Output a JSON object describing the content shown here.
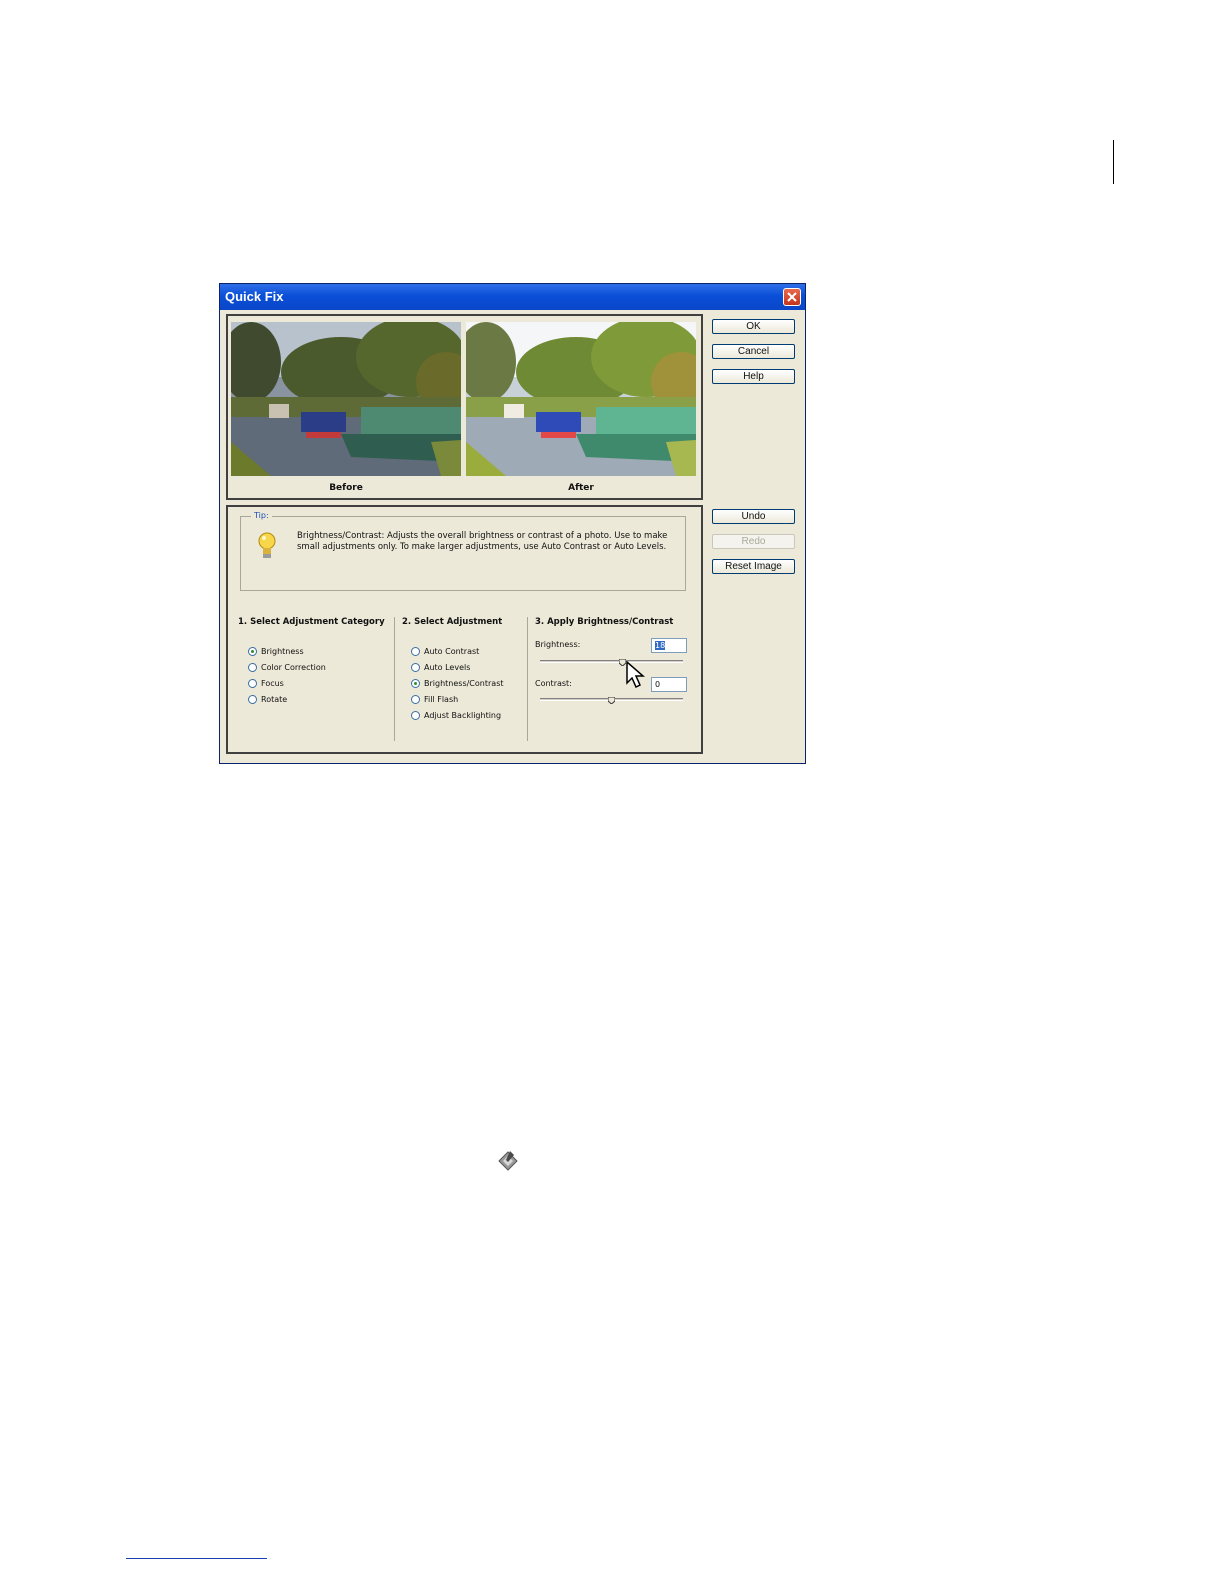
{
  "dialog": {
    "title": "Quick Fix",
    "buttons": {
      "ok": "OK",
      "cancel": "Cancel",
      "help": "Help",
      "undo": "Undo",
      "redo": "Redo",
      "reset_image": "Reset Image"
    },
    "preview": {
      "before_label": "Before",
      "after_label": "After"
    },
    "tip": {
      "legend": "Tip:",
      "text": "Brightness/Contrast: Adjusts the overall brightness or contrast of a photo. Use to make small adjustments only. To make larger adjustments, use Auto Contrast or Auto Levels."
    },
    "category": {
      "heading": "1. Select Adjustment Category",
      "options": [
        "Brightness",
        "Color Correction",
        "Focus",
        "Rotate"
      ],
      "selected": "Brightness"
    },
    "adjustment": {
      "heading": "2. Select Adjustment",
      "options": [
        "Auto Contrast",
        "Auto Levels",
        "Brightness/Contrast",
        "Fill Flash",
        "Adjust Backlighting"
      ],
      "selected": "Brightness/Contrast"
    },
    "apply": {
      "heading": "3. Apply Brightness/Contrast",
      "brightness_label": "Brightness:",
      "brightness_value": "18",
      "brightness_slider_fraction": 0.58,
      "contrast_label": "Contrast:",
      "contrast_value": "0",
      "contrast_slider_fraction": 0.5
    }
  },
  "icons": {
    "close": "close-icon",
    "tip": "lightbulb-icon",
    "cursor": "arrow-cursor-icon",
    "tool": "quick-fix-tool-icon"
  },
  "colors": {
    "titlebar": "#0a4fd8",
    "dialog_bg": "#ece9d8",
    "close_button": "#c2361b",
    "selection": "#316ac5"
  }
}
